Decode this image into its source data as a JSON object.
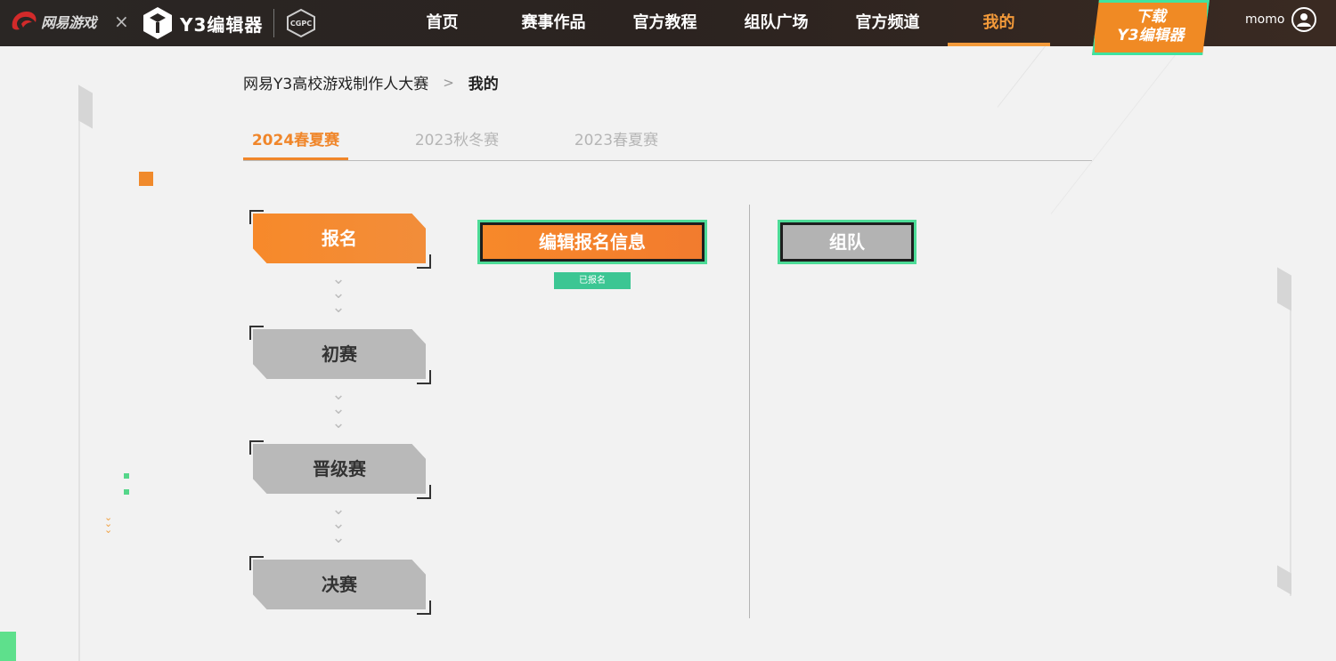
{
  "nav": {
    "netease_text": "网易游戏",
    "cross": "×",
    "y3_text": "Y3编辑器",
    "cgpc_text": "CGPC",
    "items": [
      {
        "label": "首页"
      },
      {
        "label": "赛事作品"
      },
      {
        "label": "官方教程"
      },
      {
        "label": "组队广场"
      },
      {
        "label": "官方频道"
      },
      {
        "label": "我的",
        "active": true
      }
    ],
    "download_line1": "下载",
    "download_line2": "Y3编辑器",
    "username": "momo",
    "accent_color": "#f39a3a"
  },
  "breadcrumb": {
    "parent": "网易Y3高校游戏制作人大赛",
    "separator": ">",
    "current": "我的"
  },
  "seasons": [
    {
      "label": "2024春夏赛",
      "active": true
    },
    {
      "label": "2023秋冬赛"
    },
    {
      "label": "2023春夏赛"
    }
  ],
  "stages": [
    {
      "label": "报名",
      "active": true
    },
    {
      "label": "初赛"
    },
    {
      "label": "晋级赛"
    },
    {
      "label": "决赛"
    }
  ],
  "actions": {
    "edit_label": "编辑报名信息",
    "status_badge": "已报名",
    "team_label": "组队"
  },
  "colors": {
    "orange": "#f7892a",
    "green_border": "#4ddb97",
    "badge_green": "#3cc693",
    "stage_gray": "#b9b9b9"
  }
}
